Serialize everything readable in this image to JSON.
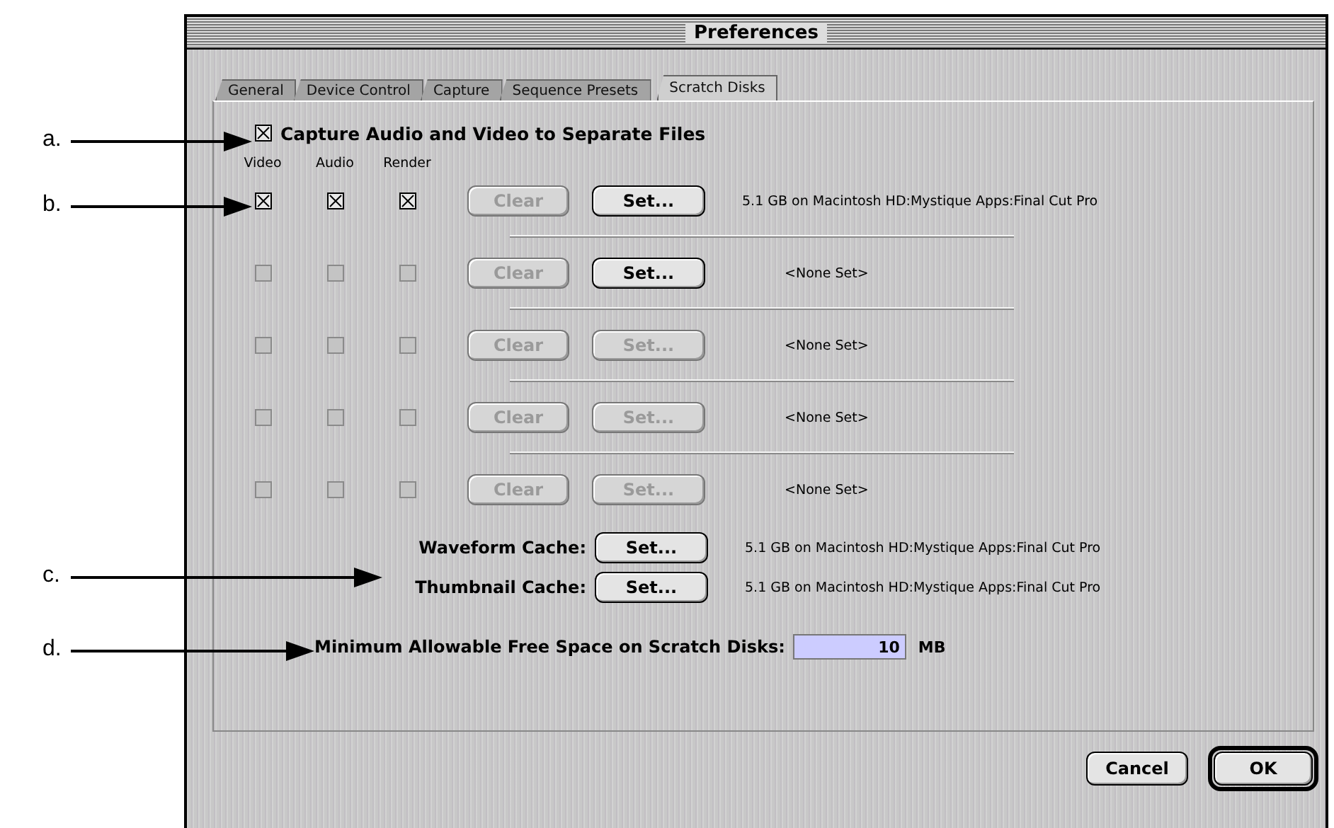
{
  "window": {
    "title": "Preferences"
  },
  "tabs": [
    {
      "label": "General",
      "selected": false
    },
    {
      "label": "Device Control",
      "selected": false
    },
    {
      "label": "Capture",
      "selected": false
    },
    {
      "label": "Sequence Presets",
      "selected": false
    },
    {
      "label": "Scratch Disks",
      "selected": true
    }
  ],
  "separate_files": {
    "label": "Capture Audio and Video to Separate Files",
    "checked": true
  },
  "disk_columns": [
    "Video",
    "Audio",
    "Render"
  ],
  "disks": [
    {
      "checks": [
        {
          "checked": true,
          "disabled": false
        },
        {
          "checked": true,
          "disabled": false
        },
        {
          "checked": true,
          "disabled": false
        }
      ],
      "clear": {
        "label": "Clear",
        "disabled": true
      },
      "set": {
        "label": "Set...",
        "disabled": false
      },
      "location": "5.1 GB on Macintosh HD:Mystique Apps:Final Cut Pro"
    },
    {
      "checks": [
        {
          "checked": false,
          "disabled": true
        },
        {
          "checked": false,
          "disabled": true
        },
        {
          "checked": false,
          "disabled": true
        }
      ],
      "clear": {
        "label": "Clear",
        "disabled": true
      },
      "set": {
        "label": "Set...",
        "disabled": false
      },
      "location": "<None Set>"
    },
    {
      "checks": [
        {
          "checked": false,
          "disabled": true
        },
        {
          "checked": false,
          "disabled": true
        },
        {
          "checked": false,
          "disabled": true
        }
      ],
      "clear": {
        "label": "Clear",
        "disabled": true
      },
      "set": {
        "label": "Set...",
        "disabled": true
      },
      "location": "<None Set>"
    },
    {
      "checks": [
        {
          "checked": false,
          "disabled": true
        },
        {
          "checked": false,
          "disabled": true
        },
        {
          "checked": false,
          "disabled": true
        }
      ],
      "clear": {
        "label": "Clear",
        "disabled": true
      },
      "set": {
        "label": "Set...",
        "disabled": true
      },
      "location": "<None Set>"
    },
    {
      "checks": [
        {
          "checked": false,
          "disabled": true
        },
        {
          "checked": false,
          "disabled": true
        },
        {
          "checked": false,
          "disabled": true
        }
      ],
      "clear": {
        "label": "Clear",
        "disabled": true
      },
      "set": {
        "label": "Set...",
        "disabled": true
      },
      "location": "<None Set>"
    }
  ],
  "caches": [
    {
      "label": "Waveform Cache:",
      "button": "Set...",
      "location": "5.1 GB on Macintosh HD:Mystique Apps:Final Cut Pro"
    },
    {
      "label": "Thumbnail Cache:",
      "button": "Set...",
      "location": "5.1 GB on Macintosh HD:Mystique Apps:Final Cut Pro"
    }
  ],
  "min_free_space": {
    "label": "Minimum Allowable Free Space on Scratch Disks:",
    "value": "10",
    "unit": "MB"
  },
  "buttons": [
    {
      "label": "Cancel",
      "default": false
    },
    {
      "label": "OK",
      "default": true
    }
  ],
  "annotations": [
    {
      "label": "a."
    },
    {
      "label": "b."
    },
    {
      "label": "c."
    },
    {
      "label": "d."
    }
  ]
}
